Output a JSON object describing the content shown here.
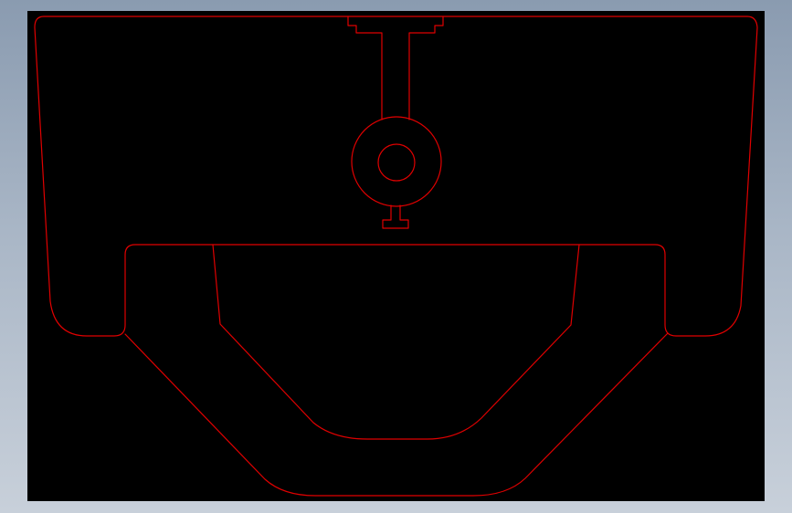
{
  "viewport": {
    "background": "#000000",
    "stroke_color": "#e00000"
  },
  "drawing": {
    "entities": [
      "outer-profile",
      "inner-profile",
      "center-slot",
      "bore-outer-circle",
      "bore-inner-circle",
      "stem-profile",
      "key-tab"
    ]
  }
}
